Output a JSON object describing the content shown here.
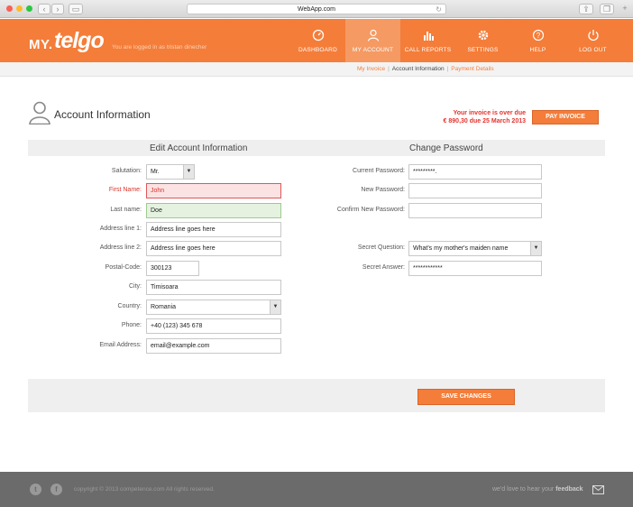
{
  "browser": {
    "url": "WebApp.com"
  },
  "header": {
    "logo_prefix": "MY.",
    "logo_brand": "telgo",
    "logged_in_text": "You are logged in as tristan dinecher",
    "nav": [
      {
        "label": "DASHBOARD",
        "icon": "dashboard-icon"
      },
      {
        "label": "MY ACCOUNT",
        "icon": "user-icon"
      },
      {
        "label": "CALL REPORTS",
        "icon": "bar-chart-icon"
      },
      {
        "label": "SETTINGS",
        "icon": "gear-icon"
      },
      {
        "label": "HELP",
        "icon": "question-icon"
      },
      {
        "label": "LOG OUT",
        "icon": "power-icon"
      }
    ]
  },
  "subnav": {
    "items": [
      "My Invoice",
      "Account Information",
      "Payment Details"
    ]
  },
  "page": {
    "title": "Account Information",
    "invoice_warning_line1": "Your invoice is over due",
    "invoice_warning_line2": "€ 890,30 due 25 March 2013",
    "pay_button": "PAY INVOICE"
  },
  "account": {
    "section_title": "Edit Account Information",
    "salutation_label": "Salutation:",
    "salutation_value": "Mr.",
    "first_name_label": "First Name:",
    "first_name_value": "John",
    "last_name_label": "Last name:",
    "last_name_value": "Doe",
    "address1_label": "Address line 1:",
    "address1_value": "Address line goes here",
    "address2_label": "Address line 2:",
    "address2_value": "Address line goes here",
    "postal_label": "Postal-Code:",
    "postal_value": "300123",
    "city_label": "City:",
    "city_value": "Timisoara",
    "country_label": "Country:",
    "country_value": "Romania",
    "phone_label": "Phone:",
    "phone_value": "+40 (123) 345 678",
    "email_label": "Email Address:",
    "email_value": "email@example.com"
  },
  "password": {
    "section_title": "Change Password",
    "current_label": "Current Password:",
    "current_value": "*********.",
    "new_label": "New Password:",
    "new_value": "",
    "confirm_label": "Confirm New Password:",
    "confirm_value": "",
    "question_label": "Secret Question:",
    "question_value": "What's my mother's maiden name",
    "answer_label": "Secret Answer:",
    "answer_value": "************"
  },
  "actions": {
    "save_button": "SAVE CHANGES"
  },
  "footer": {
    "copyright": "copyright © 2013 competence.com All rights reserved.",
    "feedback_prefix": "we'd love to hear your",
    "feedback_word": "feedback"
  },
  "colors": {
    "accent": "#f47d39",
    "error": "#d9342b",
    "success_bg": "#e4f2df"
  }
}
